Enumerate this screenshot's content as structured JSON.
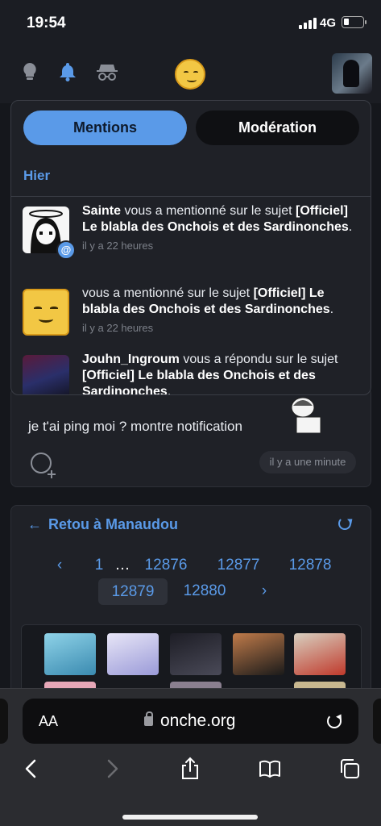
{
  "status_bar": {
    "time": "19:54",
    "network": "4G"
  },
  "nav": {
    "icons": [
      "lightbulb-icon",
      "bell-icon",
      "incognito-icon"
    ],
    "logo": "smiley-logo"
  },
  "notifications": {
    "tabs": [
      {
        "label": "Mentions",
        "active": true
      },
      {
        "label": "Modération",
        "active": false
      }
    ],
    "day_label": "Hier",
    "items": [
      {
        "user": "Sainte",
        "action": " vous a mentionné sur le sujet ",
        "topic": "[Officiel] Le blabla des Onchois et des Sardinonches",
        "end": ".",
        "time": "il y a 22 heures",
        "badge": "@"
      },
      {
        "user": "",
        "action": "vous a mentionné sur le sujet ",
        "topic": "[Officiel] Le blabla des Onchois et des Sardinonches",
        "end": ".",
        "time": "il y a 22 heures"
      },
      {
        "user": "Jouhn_Ingroum",
        "action": " vous a répondu sur le sujet ",
        "topic": "[Officiel] Le blabla des Onchois et des Sardinonches",
        "end": ".",
        "time": ""
      }
    ]
  },
  "post": {
    "text": "je t'ai ping moi ? montre notification",
    "time": "il y a une minute"
  },
  "topic": {
    "back_label": "Retou à Manaudou",
    "pages": {
      "prev": "‹",
      "first": "1",
      "ellipsis": "…",
      "p1": "12876",
      "p2": "12877",
      "p3": "12878",
      "current": "12879",
      "p4": "12880",
      "next": "›"
    }
  },
  "safari": {
    "aa": "AA",
    "domain": "onche.org"
  },
  "colors": {
    "accent": "#5a9ae8",
    "background": "#15171c",
    "card": "#1f2127"
  }
}
